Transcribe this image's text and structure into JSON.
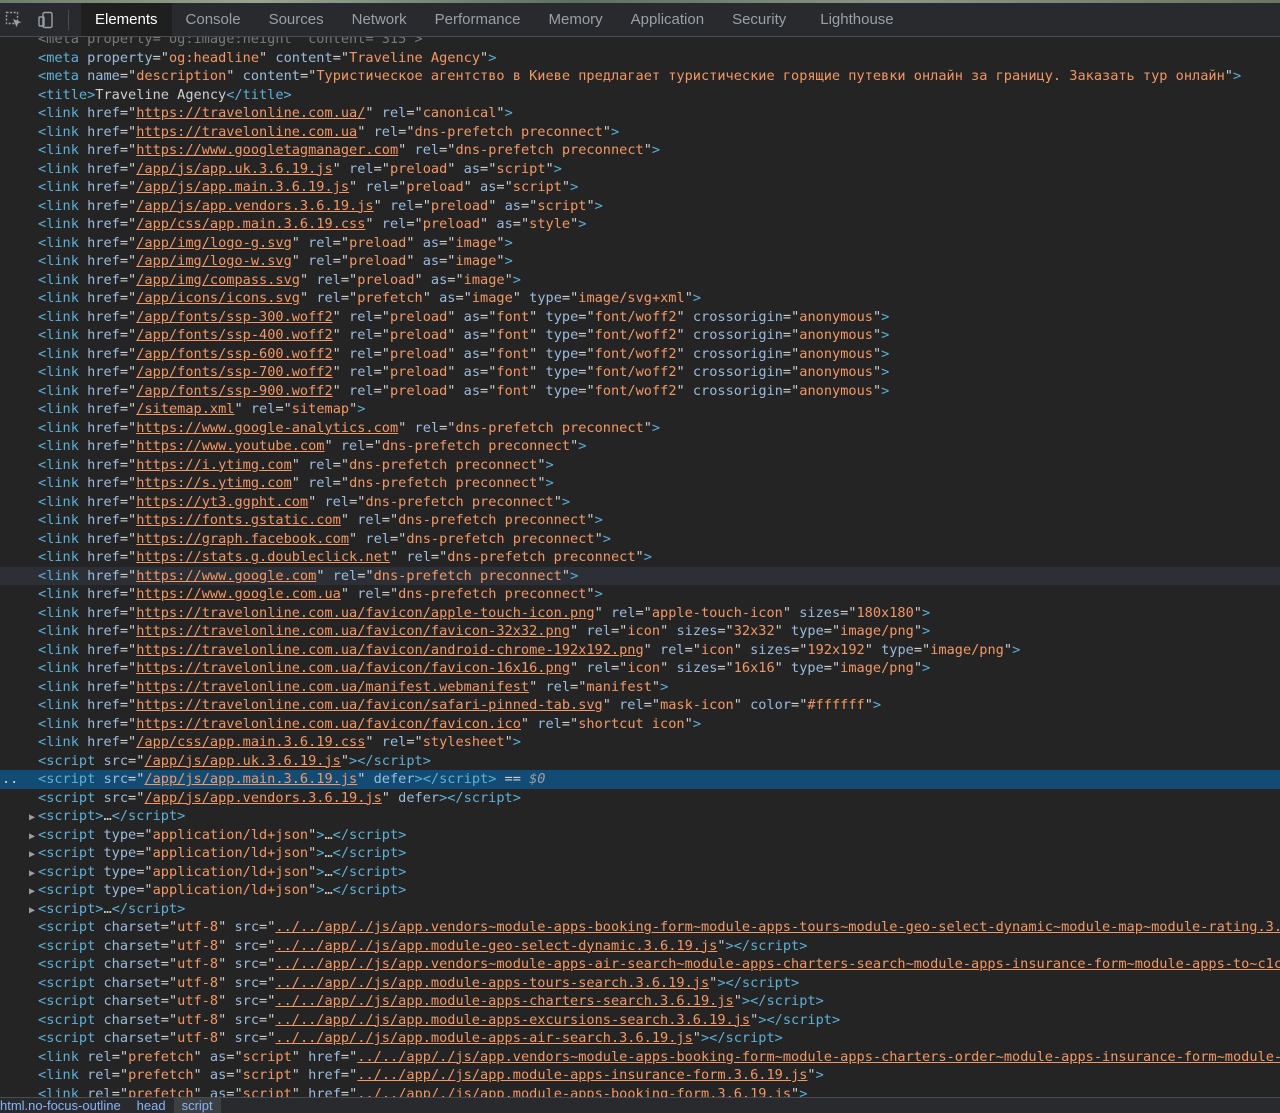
{
  "toolbar": {
    "tabs": [
      "Elements",
      "Console",
      "Sources",
      "Network",
      "Performance",
      "Memory",
      "Application",
      "Security",
      "Lighthouse"
    ],
    "active_tab": "Elements",
    "icons": [
      "inspect-element-icon",
      "device-toolbar-icon"
    ]
  },
  "dom_lines": [
    {
      "ghost": "<meta property=\"og:image:height\" content=\"315\">"
    },
    {
      "tag": "meta",
      "attrs": [
        [
          "property",
          "og:headline"
        ],
        [
          "content",
          "Traveline Agency"
        ]
      ]
    },
    {
      "tag": "meta",
      "attrs": [
        [
          "name",
          "description"
        ],
        [
          "content",
          "Туристическое агентство в Киеве предлагает туристические горящие путевки онлайн за границу. Заказать тур онлайн"
        ]
      ]
    },
    {
      "tag": "title",
      "text": "Traveline Agency",
      "close": "title"
    },
    {
      "tag": "link",
      "attrs": [
        [
          "href",
          "https://travelonline.com.ua/",
          "link"
        ],
        [
          "rel",
          "canonical"
        ]
      ]
    },
    {
      "tag": "link",
      "attrs": [
        [
          "href",
          "https://travelonline.com.ua",
          "link"
        ],
        [
          "rel",
          "dns-prefetch preconnect"
        ]
      ]
    },
    {
      "tag": "link",
      "attrs": [
        [
          "href",
          "https://www.googletagmanager.com",
          "link"
        ],
        [
          "rel",
          "dns-prefetch preconnect"
        ]
      ]
    },
    {
      "tag": "link",
      "attrs": [
        [
          "href",
          "/app/js/app.uk.3.6.19.js",
          "link"
        ],
        [
          "rel",
          "preload"
        ],
        [
          "as",
          "script"
        ]
      ]
    },
    {
      "tag": "link",
      "attrs": [
        [
          "href",
          "/app/js/app.main.3.6.19.js",
          "link"
        ],
        [
          "rel",
          "preload"
        ],
        [
          "as",
          "script"
        ]
      ]
    },
    {
      "tag": "link",
      "attrs": [
        [
          "href",
          "/app/js/app.vendors.3.6.19.js",
          "link"
        ],
        [
          "rel",
          "preload"
        ],
        [
          "as",
          "script"
        ]
      ]
    },
    {
      "tag": "link",
      "attrs": [
        [
          "href",
          "/app/css/app.main.3.6.19.css",
          "link"
        ],
        [
          "rel",
          "preload"
        ],
        [
          "as",
          "style"
        ]
      ]
    },
    {
      "tag": "link",
      "attrs": [
        [
          "href",
          "/app/img/logo-g.svg",
          "link"
        ],
        [
          "rel",
          "preload"
        ],
        [
          "as",
          "image"
        ]
      ]
    },
    {
      "tag": "link",
      "attrs": [
        [
          "href",
          "/app/img/logo-w.svg",
          "link"
        ],
        [
          "rel",
          "preload"
        ],
        [
          "as",
          "image"
        ]
      ]
    },
    {
      "tag": "link",
      "attrs": [
        [
          "href",
          "/app/img/compass.svg",
          "link"
        ],
        [
          "rel",
          "preload"
        ],
        [
          "as",
          "image"
        ]
      ]
    },
    {
      "tag": "link",
      "attrs": [
        [
          "href",
          "/app/icons/icons.svg",
          "link"
        ],
        [
          "rel",
          "prefetch"
        ],
        [
          "as",
          "image"
        ],
        [
          "type",
          "image/svg+xml"
        ]
      ]
    },
    {
      "tag": "link",
      "attrs": [
        [
          "href",
          "/app/fonts/ssp-300.woff2",
          "link"
        ],
        [
          "rel",
          "preload"
        ],
        [
          "as",
          "font"
        ],
        [
          "type",
          "font/woff2"
        ],
        [
          "crossorigin",
          "anonymous"
        ]
      ]
    },
    {
      "tag": "link",
      "attrs": [
        [
          "href",
          "/app/fonts/ssp-400.woff2",
          "link"
        ],
        [
          "rel",
          "preload"
        ],
        [
          "as",
          "font"
        ],
        [
          "type",
          "font/woff2"
        ],
        [
          "crossorigin",
          "anonymous"
        ]
      ]
    },
    {
      "tag": "link",
      "attrs": [
        [
          "href",
          "/app/fonts/ssp-600.woff2",
          "link"
        ],
        [
          "rel",
          "preload"
        ],
        [
          "as",
          "font"
        ],
        [
          "type",
          "font/woff2"
        ],
        [
          "crossorigin",
          "anonymous"
        ]
      ]
    },
    {
      "tag": "link",
      "attrs": [
        [
          "href",
          "/app/fonts/ssp-700.woff2",
          "link"
        ],
        [
          "rel",
          "preload"
        ],
        [
          "as",
          "font"
        ],
        [
          "type",
          "font/woff2"
        ],
        [
          "crossorigin",
          "anonymous"
        ]
      ]
    },
    {
      "tag": "link",
      "attrs": [
        [
          "href",
          "/app/fonts/ssp-900.woff2",
          "link"
        ],
        [
          "rel",
          "preload"
        ],
        [
          "as",
          "font"
        ],
        [
          "type",
          "font/woff2"
        ],
        [
          "crossorigin",
          "anonymous"
        ]
      ]
    },
    {
      "tag": "link",
      "attrs": [
        [
          "href",
          "/sitemap.xml",
          "link"
        ],
        [
          "rel",
          "sitemap"
        ]
      ]
    },
    {
      "tag": "link",
      "attrs": [
        [
          "href",
          "https://www.google-analytics.com",
          "link"
        ],
        [
          "rel",
          "dns-prefetch preconnect"
        ]
      ]
    },
    {
      "tag": "link",
      "attrs": [
        [
          "href",
          "https://www.youtube.com",
          "link"
        ],
        [
          "rel",
          "dns-prefetch preconnect"
        ]
      ]
    },
    {
      "tag": "link",
      "attrs": [
        [
          "href",
          "https://i.ytimg.com",
          "link"
        ],
        [
          "rel",
          "dns-prefetch preconnect"
        ]
      ]
    },
    {
      "tag": "link",
      "attrs": [
        [
          "href",
          "https://s.ytimg.com",
          "link"
        ],
        [
          "rel",
          "dns-prefetch preconnect"
        ]
      ]
    },
    {
      "tag": "link",
      "attrs": [
        [
          "href",
          "https://yt3.ggpht.com",
          "link"
        ],
        [
          "rel",
          "dns-prefetch preconnect"
        ]
      ]
    },
    {
      "tag": "link",
      "attrs": [
        [
          "href",
          "https://fonts.gstatic.com",
          "link"
        ],
        [
          "rel",
          "dns-prefetch preconnect"
        ]
      ]
    },
    {
      "tag": "link",
      "attrs": [
        [
          "href",
          "https://graph.facebook.com",
          "link"
        ],
        [
          "rel",
          "dns-prefetch preconnect"
        ]
      ]
    },
    {
      "tag": "link",
      "attrs": [
        [
          "href",
          "https://stats.g.doubleclick.net",
          "link"
        ],
        [
          "rel",
          "dns-prefetch preconnect"
        ]
      ]
    },
    {
      "tag": "link",
      "hover": true,
      "attrs": [
        [
          "href",
          "https://www.google.com",
          "link"
        ],
        [
          "rel",
          "dns-prefetch preconnect"
        ]
      ]
    },
    {
      "tag": "link",
      "attrs": [
        [
          "href",
          "https://www.google.com.ua",
          "link"
        ],
        [
          "rel",
          "dns-prefetch preconnect"
        ]
      ]
    },
    {
      "tag": "link",
      "attrs": [
        [
          "href",
          "https://travelonline.com.ua/favicon/apple-touch-icon.png",
          "link"
        ],
        [
          "rel",
          "apple-touch-icon"
        ],
        [
          "sizes",
          "180x180"
        ]
      ]
    },
    {
      "tag": "link",
      "attrs": [
        [
          "href",
          "https://travelonline.com.ua/favicon/favicon-32x32.png",
          "link"
        ],
        [
          "rel",
          "icon"
        ],
        [
          "sizes",
          "32x32"
        ],
        [
          "type",
          "image/png"
        ]
      ]
    },
    {
      "tag": "link",
      "attrs": [
        [
          "href",
          "https://travelonline.com.ua/favicon/android-chrome-192x192.png",
          "link"
        ],
        [
          "rel",
          "icon"
        ],
        [
          "sizes",
          "192x192"
        ],
        [
          "type",
          "image/png"
        ]
      ]
    },
    {
      "tag": "link",
      "attrs": [
        [
          "href",
          "https://travelonline.com.ua/favicon/favicon-16x16.png",
          "link"
        ],
        [
          "rel",
          "icon"
        ],
        [
          "sizes",
          "16x16"
        ],
        [
          "type",
          "image/png"
        ]
      ]
    },
    {
      "tag": "link",
      "attrs": [
        [
          "href",
          "https://travelonline.com.ua/manifest.webmanifest",
          "link"
        ],
        [
          "rel",
          "manifest"
        ]
      ]
    },
    {
      "tag": "link",
      "attrs": [
        [
          "href",
          "https://travelonline.com.ua/favicon/safari-pinned-tab.svg",
          "link"
        ],
        [
          "rel",
          "mask-icon"
        ],
        [
          "color",
          "#ffffff"
        ]
      ]
    },
    {
      "tag": "link",
      "attrs": [
        [
          "href",
          "https://travelonline.com.ua/favicon/favicon.ico",
          "link"
        ],
        [
          "rel",
          "shortcut icon"
        ]
      ]
    },
    {
      "tag": "link",
      "attrs": [
        [
          "href",
          "/app/css/app.main.3.6.19.css",
          "link"
        ],
        [
          "rel",
          "stylesheet"
        ]
      ]
    },
    {
      "tag": "script",
      "close": "script",
      "attrs": [
        [
          "src",
          "/app/js/app.uk.3.6.19.js",
          "link"
        ]
      ]
    },
    {
      "tag": "script",
      "close": "script",
      "selected": true,
      "suffix": " == $0",
      "attrs": [
        [
          "src",
          "/app/js/app.main.3.6.19.js",
          "link"
        ],
        [
          "defer"
        ]
      ]
    },
    {
      "tag": "script",
      "close": "script",
      "attrs": [
        [
          "src",
          "/app/js/app.vendors.3.6.19.js",
          "link"
        ],
        [
          "defer"
        ]
      ]
    },
    {
      "tag": "script",
      "collapsed": true,
      "text": "…",
      "close": "script"
    },
    {
      "tag": "script",
      "collapsed": true,
      "text": "…",
      "close": "script",
      "attrs": [
        [
          "type",
          "application/ld+json"
        ]
      ]
    },
    {
      "tag": "script",
      "collapsed": true,
      "text": "…",
      "close": "script",
      "attrs": [
        [
          "type",
          "application/ld+json"
        ]
      ]
    },
    {
      "tag": "script",
      "collapsed": true,
      "text": "…",
      "close": "script",
      "attrs": [
        [
          "type",
          "application/ld+json"
        ]
      ]
    },
    {
      "tag": "script",
      "collapsed": true,
      "text": "…",
      "close": "script",
      "attrs": [
        [
          "type",
          "application/ld+json"
        ]
      ]
    },
    {
      "tag": "script",
      "collapsed": true,
      "text": "…",
      "close": "script"
    },
    {
      "tag": "script",
      "close": "script",
      "attrs": [
        [
          "charset",
          "utf-8"
        ],
        [
          "src",
          "../../app/./js/app.vendors~module-apps-booking-form~module-apps-tours~module-geo-select-dynamic~module-map~module-rating.3.",
          "link"
        ]
      ],
      "truncated": true
    },
    {
      "tag": "script",
      "close": "script",
      "attrs": [
        [
          "charset",
          "utf-8"
        ],
        [
          "src",
          "../../app/./js/app.module-geo-select-dynamic.3.6.19.js",
          "link"
        ]
      ]
    },
    {
      "tag": "script",
      "close": "script",
      "attrs": [
        [
          "charset",
          "utf-8"
        ],
        [
          "src",
          "../../app/./js/app.vendors~module-apps-air-search~module-apps-charters-search~module-apps-insurance-form~module-apps-to~c1c",
          "link"
        ]
      ],
      "truncated": true
    },
    {
      "tag": "script",
      "close": "script",
      "attrs": [
        [
          "charset",
          "utf-8"
        ],
        [
          "src",
          "../../app/./js/app.module-apps-tours-search.3.6.19.js",
          "link"
        ]
      ]
    },
    {
      "tag": "script",
      "close": "script",
      "attrs": [
        [
          "charset",
          "utf-8"
        ],
        [
          "src",
          "../../app/./js/app.module-apps-charters-search.3.6.19.js",
          "link"
        ]
      ]
    },
    {
      "tag": "script",
      "close": "script",
      "attrs": [
        [
          "charset",
          "utf-8"
        ],
        [
          "src",
          "../../app/./js/app.module-apps-excursions-search.3.6.19.js",
          "link"
        ]
      ]
    },
    {
      "tag": "script",
      "close": "script",
      "attrs": [
        [
          "charset",
          "utf-8"
        ],
        [
          "src",
          "../../app/./js/app.module-apps-air-search.3.6.19.js",
          "link"
        ]
      ]
    },
    {
      "tag": "link",
      "attrs": [
        [
          "rel",
          "prefetch"
        ],
        [
          "as",
          "script"
        ],
        [
          "href",
          "../../app/./js/app.vendors~module-apps-booking-form~module-apps-charters-order~module-apps-insurance-form~module-",
          "link"
        ]
      ],
      "truncated": true
    },
    {
      "tag": "link",
      "attrs": [
        [
          "rel",
          "prefetch"
        ],
        [
          "as",
          "script"
        ],
        [
          "href",
          "../../app/./js/app.module-apps-insurance-form.3.6.19.js",
          "link"
        ]
      ]
    },
    {
      "tag": "link",
      "attrs": [
        [
          "rel",
          "prefetch"
        ],
        [
          "as",
          "script"
        ],
        [
          "href",
          "../../app/./js/app.module-apps-booking-form.3.6.19.js",
          "link"
        ]
      ]
    }
  ],
  "breadcrumbs": [
    "html.no-focus-outline",
    "head",
    "script"
  ],
  "selected_breadcrumb": "script",
  "colors": {
    "background": "#242424",
    "toolbar": "#292a2d",
    "tag": "#5db0d7",
    "attr_name": "#9bbbdc",
    "attr_value": "#f29766",
    "selection": "#124c75"
  }
}
